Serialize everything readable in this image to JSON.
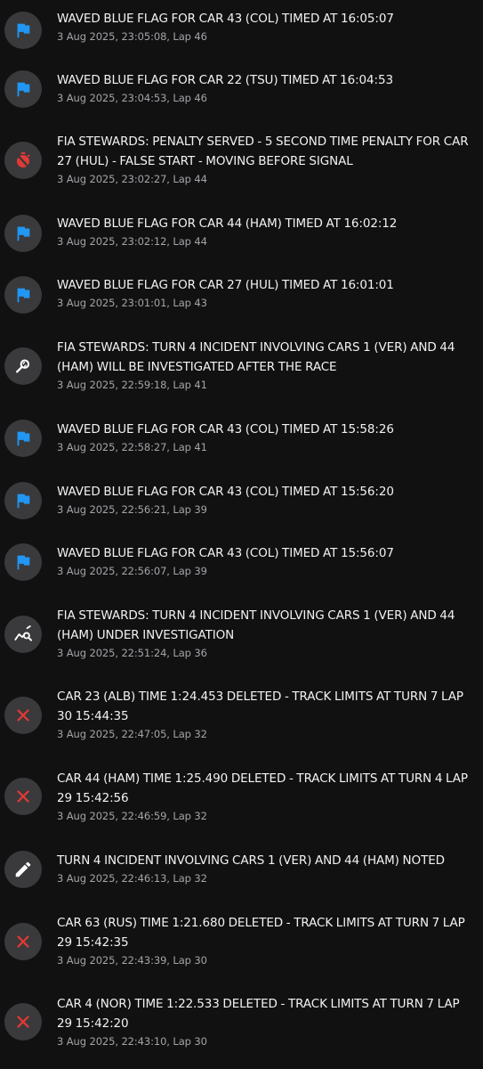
{
  "messages": [
    {
      "icon": "blue-flag-icon",
      "title": "WAVED BLUE FLAG FOR CAR 43 (COL) TIMED AT 16:05:07",
      "meta": "3 Aug 2025, 23:05:08, Lap 46"
    },
    {
      "icon": "blue-flag-icon",
      "title": "WAVED BLUE FLAG FOR CAR 22 (TSU) TIMED AT 16:04:53",
      "meta": "3 Aug 2025, 23:04:53, Lap 46"
    },
    {
      "icon": "timer-off-icon",
      "title": "FIA STEWARDS: PENALTY SERVED - 5 SECOND TIME PENALTY FOR CAR 27 (HUL) - FALSE START - MOVING BEFORE SIGNAL",
      "meta": "3 Aug 2025, 23:02:27, Lap 44"
    },
    {
      "icon": "blue-flag-icon",
      "title": "WAVED BLUE FLAG FOR CAR 44 (HAM) TIMED AT 16:02:12",
      "meta": "3 Aug 2025, 23:02:12, Lap 44"
    },
    {
      "icon": "blue-flag-icon",
      "title": "WAVED BLUE FLAG FOR CAR 27 (HUL) TIMED AT 16:01:01",
      "meta": "3 Aug 2025, 23:01:01, Lap 43"
    },
    {
      "icon": "investigate-icon",
      "title": "FIA STEWARDS: TURN 4 INCIDENT INVOLVING CARS 1 (VER) AND 44 (HAM) WILL BE INVESTIGATED AFTER THE RACE",
      "meta": "3 Aug 2025, 22:59:18, Lap 41"
    },
    {
      "icon": "blue-flag-icon",
      "title": "WAVED BLUE FLAG FOR CAR 43 (COL) TIMED AT 15:58:26",
      "meta": "3 Aug 2025, 22:58:27, Lap 41"
    },
    {
      "icon": "blue-flag-icon",
      "title": "WAVED BLUE FLAG FOR CAR 43 (COL) TIMED AT 15:56:20",
      "meta": "3 Aug 2025, 22:56:21, Lap 39"
    },
    {
      "icon": "blue-flag-icon",
      "title": "WAVED BLUE FLAG FOR CAR 43 (COL) TIMED AT 15:56:07",
      "meta": "3 Aug 2025, 22:56:07, Lap 39"
    },
    {
      "icon": "query-stats-icon",
      "title": "FIA STEWARDS: TURN 4 INCIDENT INVOLVING CARS 1 (VER) AND 44 (HAM) UNDER INVESTIGATION",
      "meta": "3 Aug 2025, 22:51:24, Lap 36"
    },
    {
      "icon": "close-icon",
      "title": "CAR 23 (ALB) TIME 1:24.453 DELETED - TRACK LIMITS AT TURN 7 LAP 30 15:44:35",
      "meta": "3 Aug 2025, 22:47:05, Lap 32"
    },
    {
      "icon": "close-icon",
      "title": "CAR 44 (HAM) TIME 1:25.490 DELETED - TRACK LIMITS AT TURN 4 LAP 29 15:42:56",
      "meta": "3 Aug 2025, 22:46:59, Lap 32"
    },
    {
      "icon": "pencil-icon",
      "title": "TURN 4 INCIDENT INVOLVING CARS 1 (VER) AND 44 (HAM) NOTED",
      "meta": "3 Aug 2025, 22:46:13, Lap 32"
    },
    {
      "icon": "close-icon",
      "title": "CAR 63 (RUS) TIME 1:21.680 DELETED - TRACK LIMITS AT TURN 7 LAP 29 15:42:35",
      "meta": "3 Aug 2025, 22:43:39, Lap 30"
    },
    {
      "icon": "close-icon",
      "title": "CAR 4 (NOR) TIME 1:22.533 DELETED - TRACK LIMITS AT TURN 7 LAP 29 15:42:20",
      "meta": "3 Aug 2025, 22:43:10, Lap 30"
    }
  ],
  "colors": {
    "flag_blue": "#2196f3",
    "red": "#e53935",
    "white": "#ffffff",
    "icon_bg": "#3a3a3c"
  }
}
